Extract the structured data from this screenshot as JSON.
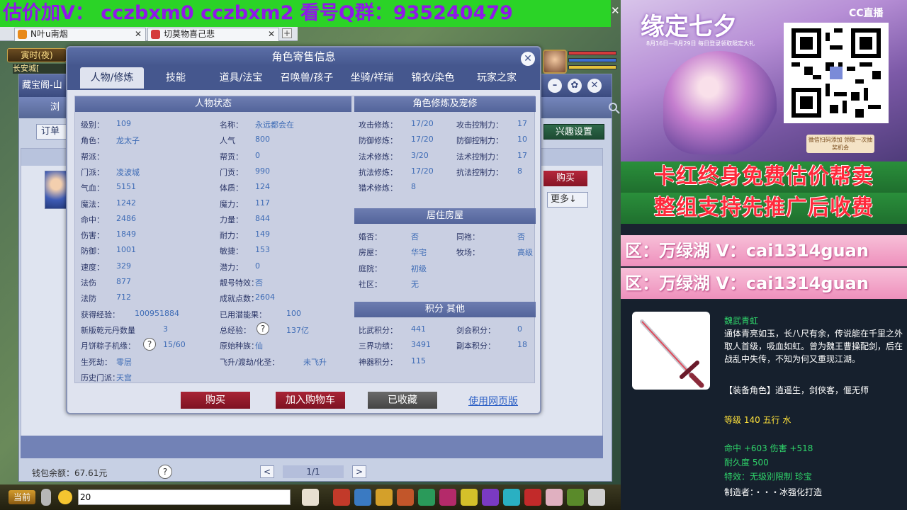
{
  "banner": {
    "text": "估价加V：  cczbxm0   cczbxm2   看号Q群：935240479",
    "close": "✕"
  },
  "browser_tabs": [
    {
      "label": "N叶u南烟",
      "close": "✕",
      "color": "#e88a1a"
    },
    {
      "label": "切莫物喜己悲",
      "close": "✕",
      "color": "#d43b3b"
    }
  ],
  "browser_new_tab": "+",
  "game": {
    "time": "寅时(夜)",
    "city": "长安城[",
    "chat_channel": "当前",
    "chat_input": "20"
  },
  "cbg": {
    "title": "藏宝阁-山",
    "nav": "浏",
    "order_btn": "订单",
    "interest_btn": "兴趣设置",
    "buy": "购买",
    "more": "更多↓",
    "minimize": "–",
    "settings": "✿",
    "close": "✕",
    "wallet": "钱包余额：67.61元",
    "help": "?",
    "page": "1/1",
    "prev": "<",
    "next": ">"
  },
  "dialog": {
    "title": "角色寄售信息",
    "close": "✕",
    "tabs": [
      "人物/修炼",
      "技能",
      "道具/法宝",
      "召唤兽/孩子",
      "坐骑/祥瑞",
      "锦衣/染色",
      "玩家之家"
    ],
    "active_tab": 0,
    "status": {
      "header": "人物状态",
      "left": [
        [
          "级别：",
          "109"
        ],
        [
          "角色：",
          "龙太子"
        ],
        [
          "帮派：",
          ""
        ],
        [
          "门派：",
          "凌波城"
        ],
        [
          "气血：",
          "5151"
        ],
        [
          "魔法：",
          "1242"
        ],
        [
          "命中：",
          "2486"
        ],
        [
          "伤害：",
          "1849"
        ],
        [
          "防御：",
          "1001"
        ],
        [
          "速度：",
          "329"
        ],
        [
          "法伤",
          "877"
        ],
        [
          "法防",
          "712"
        ],
        [
          "获得经验：",
          "100951884"
        ],
        [
          "新版乾元丹数量",
          "3"
        ],
        [
          "月饼粽子机缘：",
          "15/60"
        ],
        [
          "生死劫：",
          "零层"
        ],
        [
          "历史门派：",
          "天宫"
        ]
      ],
      "right": [
        [
          "名称：",
          "永远都会在"
        ],
        [
          "人气",
          "800"
        ],
        [
          "帮贡：",
          "0"
        ],
        [
          "门贡：",
          "990"
        ],
        [
          "体质：",
          "124"
        ],
        [
          "魔力：",
          "117"
        ],
        [
          "力量：",
          "844"
        ],
        [
          "耐力：",
          "149"
        ],
        [
          "敏捷：",
          "153"
        ],
        [
          "潜力：",
          "0"
        ],
        [
          "靓号特效：",
          "否"
        ],
        [
          "成就点数：",
          "2604"
        ],
        [
          "已用潜能果：",
          "100"
        ],
        [
          "总经验：",
          "137亿"
        ],
        [
          "原始种族：",
          "仙"
        ],
        [
          "飞升/渡劫/化圣：",
          "未飞升"
        ]
      ],
      "help": "?"
    },
    "cultivation": {
      "header": "角色修炼及宠修",
      "rows": [
        [
          "攻击修炼：",
          "17/20",
          "攻击控制力：",
          "17"
        ],
        [
          "防御修炼：",
          "17/20",
          "防御控制力：",
          "10"
        ],
        [
          "法术修炼：",
          "3/20",
          "法术控制力：",
          "17"
        ],
        [
          "抗法修炼：",
          "17/20",
          "抗法控制力：",
          "8"
        ],
        [
          "猎术修炼：",
          "8",
          "",
          ""
        ]
      ]
    },
    "house": {
      "header": "居住房屋",
      "rows": [
        [
          "婚否：",
          "否",
          "同袍：",
          "否"
        ],
        [
          "房屋：",
          "华宅",
          "牧场：",
          "高级"
        ],
        [
          "庭院：",
          "初级",
          "",
          ""
        ],
        [
          "社区：",
          "无",
          "",
          ""
        ]
      ]
    },
    "points": {
      "header": "积分 其他",
      "rows": [
        [
          "比武积分：",
          "441",
          "剑会积分：",
          "0"
        ],
        [
          "三界功绩：",
          "3491",
          "副本积分：",
          "18"
        ],
        [
          "神器积分：",
          "115",
          "",
          ""
        ]
      ]
    },
    "buttons": {
      "buy": "购买",
      "cart": "加入购物车",
      "favorited": "已收藏",
      "web": "使用网页版"
    }
  },
  "promo": {
    "title": "缘定七夕",
    "subtitle": "8月16日—8月29日 每日登录领取限定大礼",
    "cc_logo": "CC直播",
    "footer": "微信扫码添加 领取一次抽奖机会",
    "line1": "卡红终身免费估价帮卖",
    "line2": "整组支持先推广后收费",
    "v_line1": "区：万绿湖 V：cai1314guan",
    "v_line2": "区：万绿湖 V：cai1314guan"
  },
  "item": {
    "name": "魏武青虹",
    "desc": "通体青亮如玉，长八尺有余，传说能在千里之外取人首级，吸血如虹。曾为魏王曹操配剑，后在战乱中失传，不知为何又重现江湖。",
    "role": "【装备角色】逍遥生，剑侠客，偃无师",
    "level": "等级 140 五行 水",
    "hit": "命中 +603 伤害 +518",
    "durability": "耐久度 500",
    "effect": "特效：无级别限制 珍宝",
    "maker": "制造者：・・・冰强化打造"
  },
  "colors": {
    "accent": "#45578e",
    "buy_red": "#a82435",
    "value_blue": "#3d6bb5",
    "banner_green": "#2bd327",
    "banner_purple": "#8f18e8"
  }
}
